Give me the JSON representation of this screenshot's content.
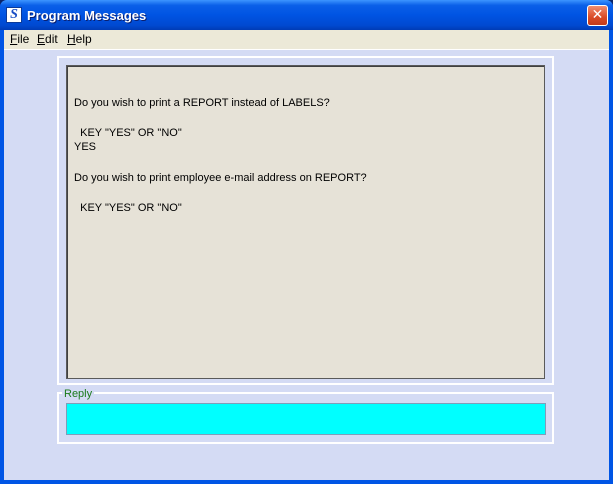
{
  "window": {
    "title": "Program Messages",
    "icon": "S"
  },
  "menu": [
    {
      "label": "File",
      "underline": "F",
      "rest": "ile"
    },
    {
      "label": "Edit",
      "underline": "E",
      "rest": "dit"
    },
    {
      "label": "Help",
      "underline": "H",
      "rest": "elp"
    }
  ],
  "messages": [
    "Do you wish to print a REPORT instead of LABELS?",
    "  KEY \"YES\" OR \"NO\"",
    "YES",
    "Do you wish to print employee e-mail address on REPORT?",
    "  KEY \"YES\" OR \"NO\""
  ],
  "reply": {
    "label": "Reply",
    "value": ""
  },
  "colors": {
    "reply_bg": "#00ffff",
    "reply_label": "#1a7a1a",
    "titlebar": "#0054e3"
  }
}
